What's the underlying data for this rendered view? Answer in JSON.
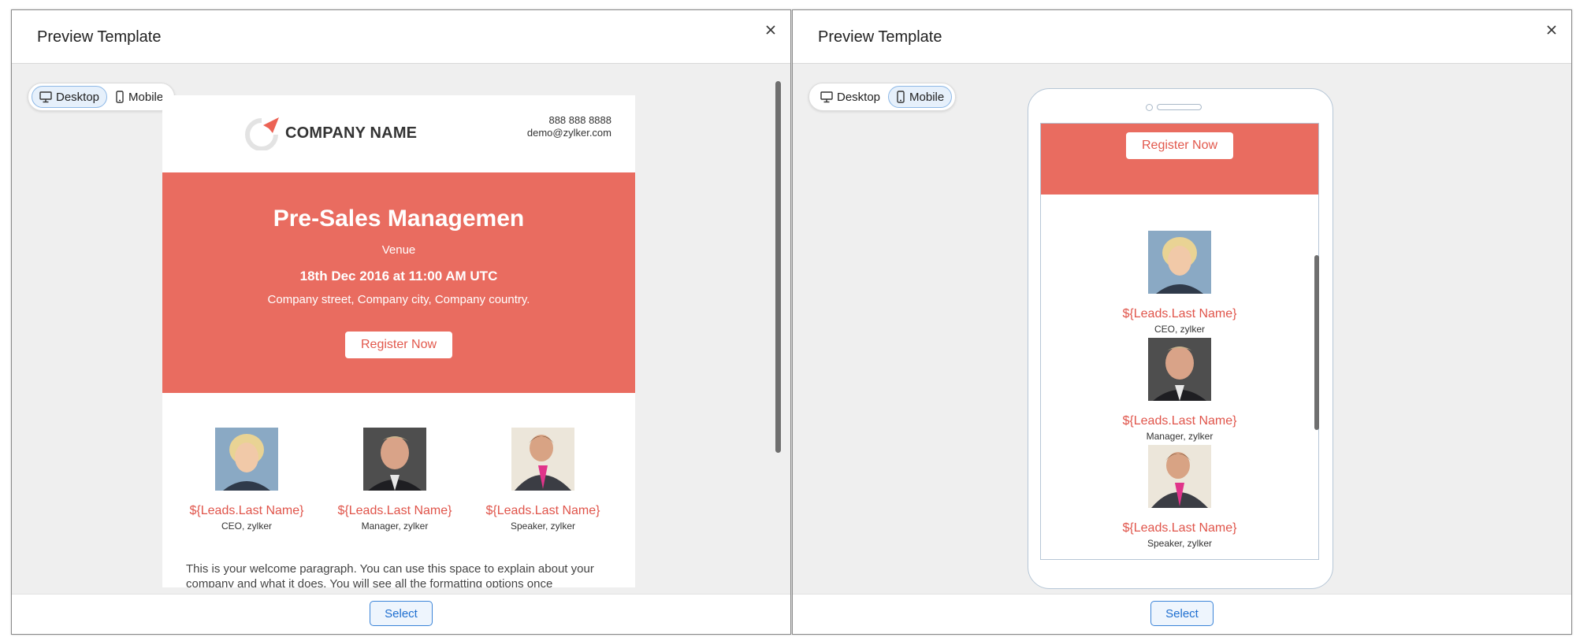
{
  "left_modal": {
    "title": "Preview Template",
    "view_toggle": {
      "desktop_label": "Desktop",
      "mobile_label": "Mobile",
      "active": "Desktop"
    },
    "select_label": "Select"
  },
  "right_modal": {
    "title": "Preview Template",
    "view_toggle": {
      "desktop_label": "Desktop",
      "mobile_label": "Mobile",
      "active": "Mobile"
    },
    "select_label": "Select"
  },
  "email": {
    "company_name": "COMPANY NAME",
    "phone": "888 888 8888",
    "email": "demo@zylker.com",
    "banner": {
      "title": "Pre-Sales Managemen",
      "venue": "Venue",
      "date": "18th Dec 2016 at 11:00 AM UTC",
      "address": "Company street, Company city, Company country.",
      "register_label": "Register Now"
    },
    "speakers": [
      {
        "name": "${Leads.Last Name}",
        "role": "CEO, zylker"
      },
      {
        "name": "${Leads.Last Name}",
        "role": "Manager, zylker"
      },
      {
        "name": "${Leads.Last Name}",
        "role": "Speaker, zylker"
      }
    ],
    "welcome_text": "This is your welcome paragraph. You can use this space to explain about your company and what it does. You will see all the formatting options once"
  },
  "colors": {
    "banner": "#e96c60",
    "accent_text": "#e0544a",
    "select_border": "#3b84d8",
    "toggle_active_bg": "#e6f0fb"
  },
  "icons": {
    "close": "close-icon",
    "desktop": "monitor-icon",
    "mobile": "phone-icon",
    "logo": "paper-plane-logo-icon"
  }
}
